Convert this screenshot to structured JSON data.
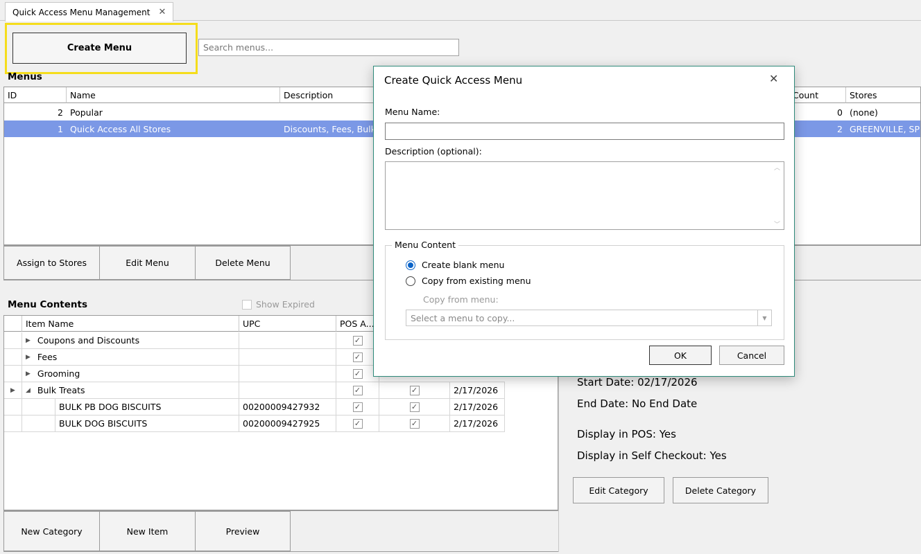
{
  "tab": {
    "title": "Quick Access Menu Management"
  },
  "toolbar": {
    "create_menu_label": "Create Menu",
    "search_placeholder": "Search menus..."
  },
  "menus": {
    "title": "Menus",
    "columns": [
      "ID",
      "Name",
      "Description",
      "Count",
      "Stores"
    ],
    "rows": [
      {
        "id": "2",
        "name": "Popular",
        "description": "",
        "count": "0",
        "stores": "(none)"
      },
      {
        "id": "1",
        "name": "Quick Access All Stores",
        "description": "Discounts, Fees, Bulk",
        "count": "2",
        "stores": "GREENVILLE, SPR"
      }
    ],
    "buttons": {
      "assign": "Assign to Stores",
      "edit": "Edit Menu",
      "delete": "Delete Menu"
    }
  },
  "contents": {
    "title": "Menu Contents",
    "show_expired": "Show Expired",
    "columns": [
      "Item Name",
      "UPC",
      "POS A..."
    ],
    "rows": [
      {
        "name": "Coupons and Discounts",
        "upc": "",
        "pos": true,
        "col4": false,
        "date": ""
      },
      {
        "name": "Fees",
        "upc": "",
        "pos": true,
        "col4": false,
        "date": ""
      },
      {
        "name": "Grooming",
        "upc": "",
        "pos": true,
        "col4": false,
        "date": ""
      },
      {
        "name": "Bulk Treats",
        "upc": "",
        "pos": true,
        "col4": true,
        "date": "2/17/2026"
      },
      {
        "name": "BULK PB DOG BISCUITS",
        "upc": "00200009427932",
        "pos": true,
        "col4": true,
        "date": "2/17/2026"
      },
      {
        "name": "BULK DOG BISCUITS",
        "upc": "00200009427925",
        "pos": true,
        "col4": true,
        "date": "2/17/2026"
      }
    ],
    "buttons": {
      "new_category": "New Category",
      "new_item": "New Item",
      "preview": "Preview"
    }
  },
  "details": {
    "start_date": "Start Date: 02/17/2026",
    "end_date": "End Date: No End Date",
    "display_pos": "Display in POS: Yes",
    "display_self_checkout": "Display in Self Checkout: Yes",
    "edit_category": "Edit Category",
    "delete_category": "Delete Category"
  },
  "dialog": {
    "title": "Create Quick Access Menu",
    "menu_name_label": "Menu Name:",
    "menu_name_value": "",
    "description_label": "Description (optional):",
    "description_value": "",
    "group_title": "Menu Content",
    "option_blank": "Create blank menu",
    "option_copy": "Copy from existing menu",
    "copy_from_label": "Copy from menu:",
    "copy_select_placeholder": "Select a menu to copy...",
    "ok": "OK",
    "cancel": "Cancel"
  },
  "colors": {
    "selection": "#7b98e6",
    "highlight": "#f5dd1c",
    "dialog_border": "#2e8a7a",
    "radio": "#0a63c8"
  }
}
